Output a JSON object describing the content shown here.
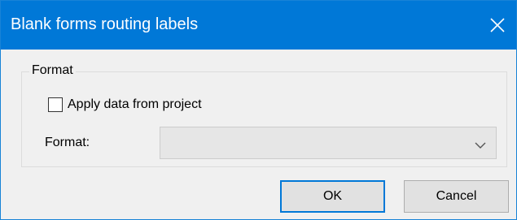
{
  "window": {
    "title": "Blank forms routing labels",
    "close_icon": "close-icon",
    "accent_color": "#0078d7"
  },
  "format_group": {
    "legend": "Format",
    "apply_checkbox": {
      "label": "Apply data from project",
      "checked": false
    },
    "format_field": {
      "label": "Format:",
      "value": "",
      "enabled": false,
      "dropdown_icon": "chevron-down-icon"
    }
  },
  "buttons": {
    "ok": "OK",
    "cancel": "Cancel"
  }
}
